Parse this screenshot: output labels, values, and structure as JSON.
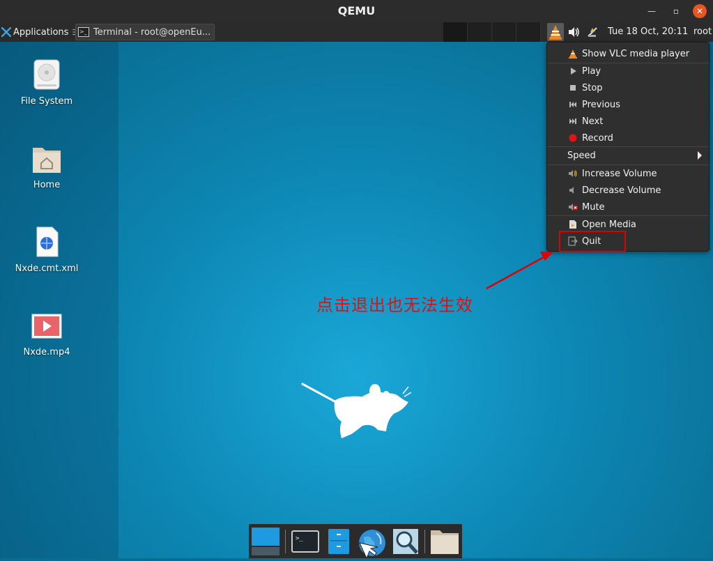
{
  "window": {
    "title": "QEMU",
    "controls": [
      "minimize-icon",
      "maximize-icon",
      "close-icon"
    ]
  },
  "panel": {
    "applications_label": "Applications",
    "applications_sep": "☰",
    "task": {
      "label": "Terminal - root@openEu..."
    },
    "workspaces": 4,
    "clock": "Tue 18 Oct, 20:11",
    "user": "root"
  },
  "desktop_icons": [
    {
      "label": "File System",
      "icon": "harddisk-icon"
    },
    {
      "label": "Home",
      "icon": "home-folder-icon"
    },
    {
      "label": "Nxde.cmt.xml",
      "icon": "xml-file-icon"
    },
    {
      "label": "Nxde.mp4",
      "icon": "video-file-icon"
    }
  ],
  "vlc_menu": {
    "items": [
      {
        "label": "Show VLC media player",
        "icon": "vlc-cone-icon"
      },
      {
        "label": "Play",
        "icon": "play-icon"
      },
      {
        "label": "Stop",
        "icon": "stop-icon"
      },
      {
        "label": "Previous",
        "icon": "previous-icon"
      },
      {
        "label": "Next",
        "icon": "next-icon"
      },
      {
        "label": "Record",
        "icon": "record-icon"
      },
      {
        "label": "Speed",
        "icon": "submenu-arrow-icon"
      },
      {
        "label": "Increase Volume",
        "icon": "volume-up-icon"
      },
      {
        "label": "Decrease Volume",
        "icon": "volume-down-icon"
      },
      {
        "label": "Mute",
        "icon": "mute-icon"
      },
      {
        "label": "Open Media",
        "icon": "open-media-icon"
      },
      {
        "label": "Quit",
        "icon": "quit-icon"
      }
    ]
  },
  "annotation": {
    "text": "点击退出也无法生效",
    "color": "#e01010"
  },
  "dock": {
    "items": [
      "show-desktop-icon",
      "terminal-icon",
      "file-manager-icon",
      "web-browser-icon",
      "app-finder-icon",
      "folder-icon"
    ]
  },
  "colors": {
    "accent_close": "#e95420",
    "panel_bg": "#2b2b2b",
    "menu_bg": "#2f2f2f",
    "annotation_red": "#e00000"
  }
}
